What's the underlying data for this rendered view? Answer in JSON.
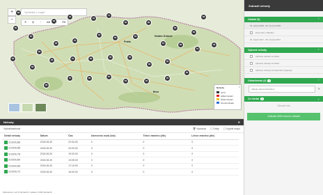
{
  "map": {
    "search_placeholder": "Vyhledej v mapě",
    "zoom_in": "+",
    "zoom_out": "−",
    "toolbar": [
      "✕",
      "◎",
      "~",
      "AB",
      "✎",
      "✐▾"
    ],
    "cities": [
      {
        "label": "Praha"
      },
      {
        "label": "Hradec Králové"
      },
      {
        "label": "Brno"
      }
    ],
    "clusters": [
      "68",
      "89",
      "63",
      "81",
      "86",
      "64",
      "44",
      "71",
      "50",
      "89",
      "63",
      "69",
      "68",
      "83",
      "96",
      "79",
      "64",
      "52",
      "64",
      "67",
      "68",
      "79",
      "46",
      "58",
      "28",
      "51",
      "82",
      "40",
      "56",
      "68",
      "85",
      "86",
      "51",
      "80",
      "87",
      "69",
      "45",
      "40",
      "66"
    ],
    "legend": {
      "title": "Nehody",
      "items": [
        {
          "label": "úmrtí",
          "color": "#333333"
        },
        {
          "label": "těžká zranění",
          "color": "#e02020"
        },
        {
          "label": "lehká zranění",
          "color": "#f7c120"
        },
        {
          "label": "hmotná škoda",
          "color": "#2f6fd6"
        }
      ]
    }
  },
  "side": {
    "title": "Zobrazit nehody",
    "sections": {
      "period": {
        "label": "Období (9)"
      },
      "range1": "01. ledna 2018 - 30. června 2018",
      "range1_opt": "Porovnat s obdobím",
      "range2": "01. ledna 2017 - 30. června 2017",
      "filters": {
        "label": "Vybrané nehody",
        "items": [
          "Vybrané nehody na dráhy",
          "Vybrané nehody na silnici",
          "Vybrané nehody na železniční přejezdy"
        ]
      },
      "locality": {
        "label": "Oblast/místo (4)",
        "badge": "1"
      },
      "locality_placeholder": "Zadejte adresu/ulici/obec",
      "more": {
        "label": "Co hledat",
        "badge": "2"
      },
      "reset_link": "Obnovit vše",
      "show_button": "Zobrazit 4000 nehod v oblasti"
    }
  },
  "table": {
    "title": "Nehody",
    "subtitle": "Vybrat/sledovat",
    "tools": [
      "Vymazat",
      "Grafy",
      "Vyplnit mapu"
    ],
    "headers": [
      "Detail nehody",
      "Datum",
      "Čas",
      "Usmrceno osob (lok)",
      "Těžce zraněno (dle)",
      "Lehce zraněno (dle)"
    ],
    "rows": [
      [
        "210301186",
        "2018.06.30",
        "22:00:00",
        "0",
        "0",
        "0"
      ],
      [
        "210301185",
        "2018.06.30",
        "20:00:00",
        "0",
        "0",
        "0"
      ],
      [
        "210301178",
        "2018.06.30",
        "19:00:00",
        "0",
        "0",
        "0"
      ],
      [
        "210301180",
        "2018.06.30",
        "13:05:00",
        "0",
        "0",
        "0"
      ],
      [
        "210301168",
        "2018.06.30",
        "17:10:00",
        "0",
        "0",
        "0"
      ],
      [
        "210301172",
        "2018.06.30",
        "16:00:00",
        "0",
        "0",
        "0"
      ]
    ],
    "footer": "Zobrazeno 1 až 6 záznamů z celkem 4 000 záznamů"
  }
}
